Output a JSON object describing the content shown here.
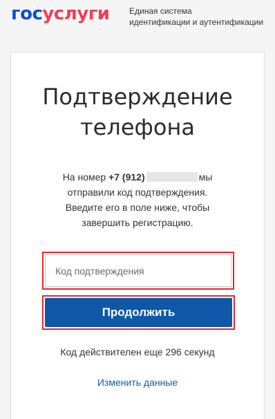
{
  "header": {
    "logo_part1": "гос",
    "logo_part2": "услуги",
    "subtitle_line1": "Единая система",
    "subtitle_line2": "идентификации и аутентификации"
  },
  "main": {
    "title_line1": "Подтверждение",
    "title_line2": "телефона",
    "desc_prefix": "На номер ",
    "phone": "+7 (912)",
    "desc_after_phone": "мы",
    "desc_line2": "отправили код подтверждения.",
    "desc_line3": "Введите его в поле ниже, чтобы",
    "desc_line4": "завершить регистрацию.",
    "code_input": {
      "placeholder": "Код подтверждения",
      "value": ""
    },
    "continue_button": "Продолжить",
    "timer_text": "Код действителен еще 296 секунд",
    "change_link": "Изменить данные"
  },
  "colors": {
    "brand_blue": "#0d4cd3",
    "brand_red": "#ee3f58",
    "button_blue": "#0f58a7",
    "highlight_red": "#e8242e",
    "link_blue": "#0d5ba8"
  }
}
